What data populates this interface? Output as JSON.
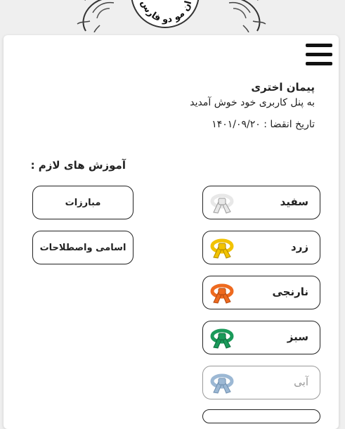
{
  "header": {
    "logo_text": "ان مو دو فارس"
  },
  "user": {
    "name": "پیمان اختری",
    "welcome": "به پنل کاربری خود خوش آمدید",
    "expiry_label": "تاریخ انقضا :",
    "expiry_date": "۱۴۰۱/۰۹/۲۰"
  },
  "section_title": "آموزش های لازم :",
  "belts": [
    {
      "label": "سفید",
      "color": "#e8e8e8",
      "stroke": "#9a9a9a",
      "enabled": true
    },
    {
      "label": "زرد",
      "color": "#f2c300",
      "stroke": "#b08a00",
      "enabled": true
    },
    {
      "label": "نارنجی",
      "color": "#ee6a1f",
      "stroke": "#b04810",
      "enabled": true
    },
    {
      "label": "سبز",
      "color": "#1a9a5a",
      "stroke": "#0e6a3c",
      "enabled": true
    },
    {
      "label": "آبی",
      "color": "#9cb8d4",
      "stroke": "#6f8fb0",
      "enabled": false
    }
  ],
  "side_buttons": [
    {
      "label": "مبارزات"
    },
    {
      "label": "اسامی واصطلاحات"
    }
  ]
}
